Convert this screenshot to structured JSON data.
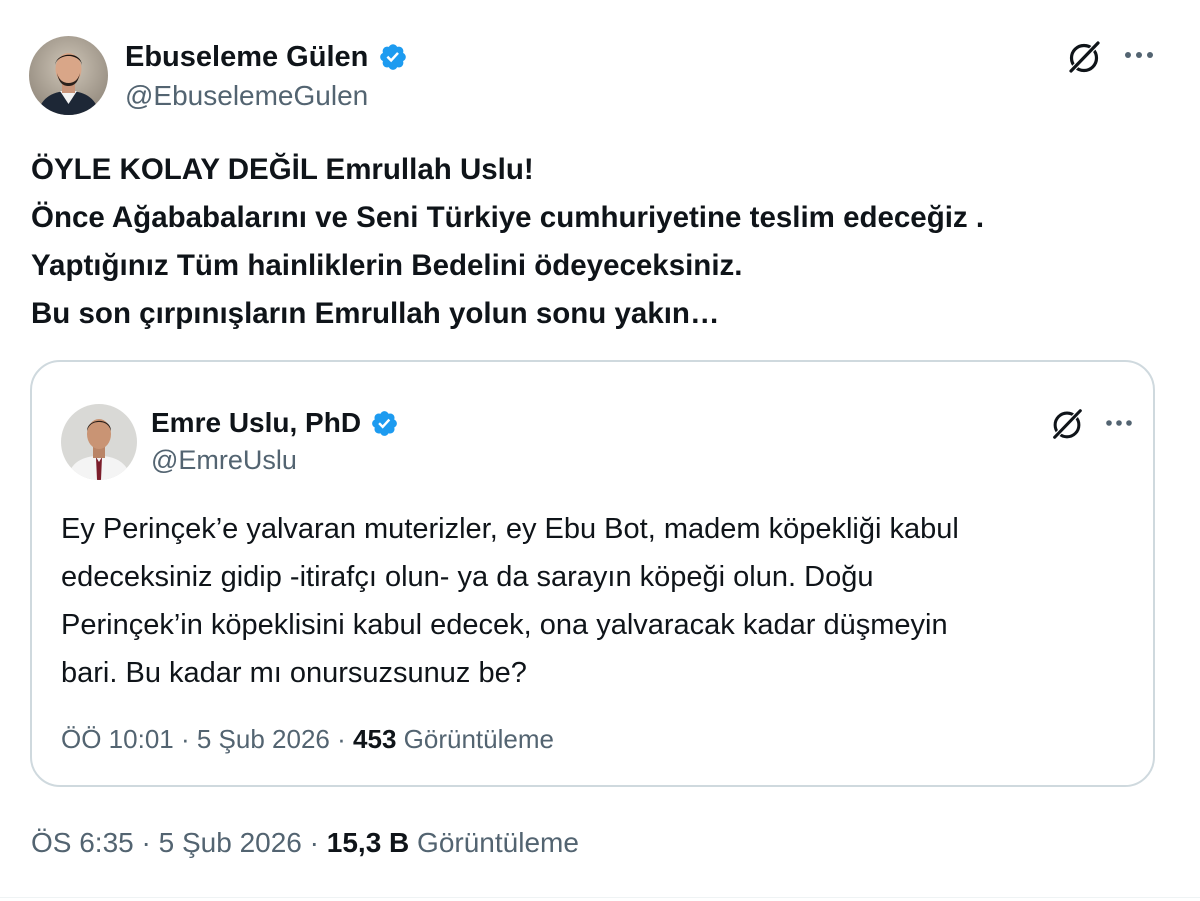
{
  "accent_color": "#1d9bf0",
  "main_tweet": {
    "author": {
      "name": "Ebuseleme Gülen",
      "handle": "@EbuselemeGulen",
      "verified": true
    },
    "text_lines": [
      "ÖYLE KOLAY DEĞİL Emrullah Uslu!",
      "Önce Ağababalarını ve Seni Türkiye cumhuriyetine teslim edeceğiz .",
      "Yaptığınız Tüm hainliklerin Bedelini ödeyeceksiniz.",
      "Bu son çırpınışların Emrullah yolun sonu yakın…"
    ],
    "meta": {
      "time": "ÖS 6:35",
      "separator": "·",
      "date": "5 Şub 2026",
      "views_count": "15,3 B",
      "views_label": "Görüntüleme"
    }
  },
  "quoted_tweet": {
    "author": {
      "name": "Emre Uslu, PhD",
      "handle": "@EmreUslu",
      "verified": true
    },
    "text_lines": [
      "Ey Perinçek’e yalvaran muterizler, ey Ebu Bot, madem köpekliği kabul",
      "edeceksiniz gidip -itirafçı olun- ya da sarayın köpeği olun. Doğu",
      "Perinçek’in köpeklisini kabul edecek, ona yalvaracak kadar düşmeyin",
      "bari. Bu kadar mı onursuzsunuz be?"
    ],
    "meta": {
      "time": "ÖÖ 10:01",
      "separator": "·",
      "date": "5 Şub 2026",
      "views_count": "453",
      "views_label": "Görüntüleme"
    }
  },
  "icons": {
    "verified": "verified-badge-icon",
    "grok": "grok-icon",
    "more": "more-icon"
  }
}
